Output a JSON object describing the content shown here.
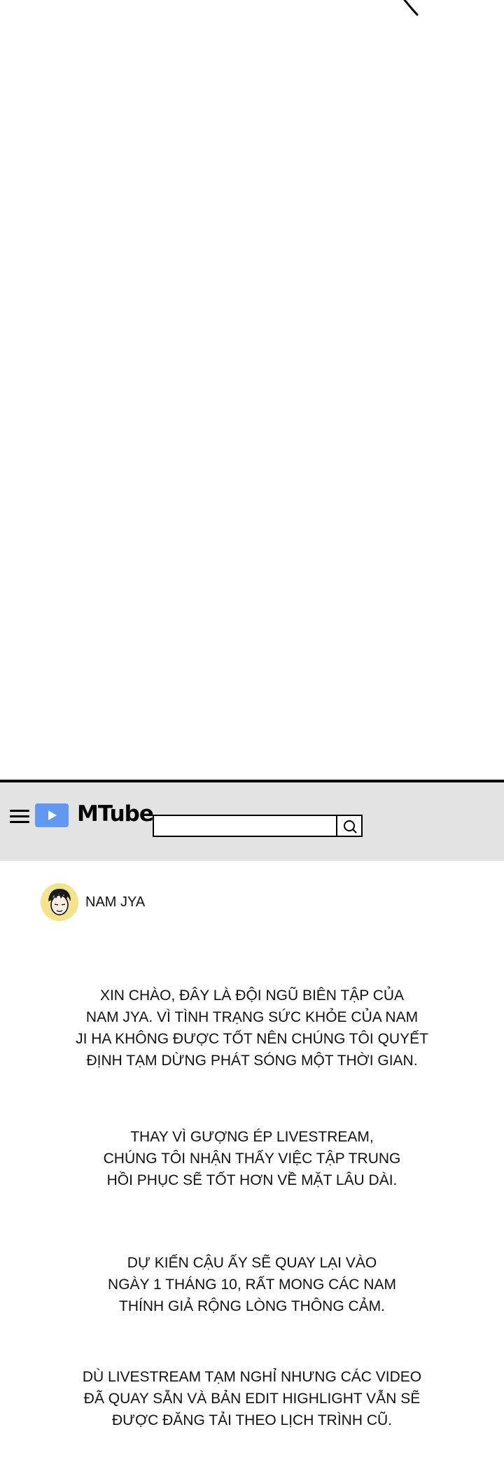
{
  "app": {
    "name": "MTube",
    "search_placeholder": ""
  },
  "channel": {
    "name": "NAM JYA"
  },
  "messages": [
    "XIN CHÀO, ĐÂY LÀ ĐỘI NGŨ BIÊN TẬP CỦA\nNAM JYA. VÌ TÌNH TRẠNG SỨC KHỎE CỦA NAM\nJI HA KHÔNG ĐƯỢC TỐT NÊN CHÚNG TÔI QUYẾT\nĐỊNH TẠM DỪNG PHÁT SÓNG MỘT THỜI GIAN.",
    "THAY VÌ GƯỢNG ÉP LIVESTREAM,\nCHÚNG TÔI NHẬN THẤY VIỆC TẬP TRUNG\nHỒI PHỤC SẼ TỐT HƠN VỀ MẶT LÂU DÀI.",
    "DỰ KIẾN CẬU ẤY SẼ QUAY LẠI VÀO\nNGÀY 1 THÁNG 10, RẤT MONG CÁC NAM\nTHÍNH GIẢ RỘNG LÒNG THÔNG CẢM.",
    "DÙ LIVESTREAM TẠM NGHỈ NHƯNG CÁC VIDEO\nĐÃ QUAY SẴN VÀ BẢN EDIT HIGHLIGHT VẪN SẼ\nĐƯỢC ĐĂNG TẢI THEO LỊCH TRÌNH CŨ."
  ],
  "colors": {
    "topbar_bg": "#e3e3e3",
    "logo_accent": "#6199f0",
    "avatar_bg": "#f3e38c",
    "text": "#111111"
  },
  "icons": [
    "menu-icon",
    "play-icon",
    "search-icon"
  ]
}
